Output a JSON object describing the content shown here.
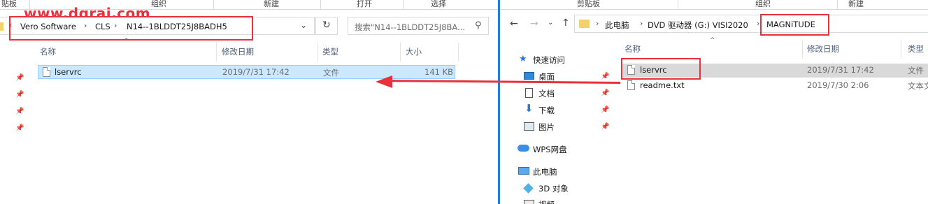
{
  "watermark": "www.dgrai.com",
  "left": {
    "ribbon": [
      "贴板",
      "组织",
      "新建",
      "打开",
      "选择"
    ],
    "address": {
      "crumbs": [
        "Vero Software",
        "CLS",
        "N14--1BLDDT25J8BADH5"
      ],
      "dropdown_icon": "chevron-down-icon",
      "refresh_icon": "refresh-icon"
    },
    "search": {
      "placeholder": "搜索\"N14--1BLDDT25J8BA..."
    },
    "columns": [
      "名称",
      "修改日期",
      "类型",
      "大小"
    ],
    "files": [
      {
        "name": "lservrc",
        "date": "2019/7/31 17:42",
        "type": "文件",
        "size": "141 KB",
        "selected": true
      }
    ]
  },
  "right": {
    "ribbon": [
      "剪贴板",
      "组织",
      "新建"
    ],
    "address": {
      "crumbs": [
        "此电脑",
        "DVD 驱动器 (G:) VISI2020",
        "MAGNiTUDE"
      ]
    },
    "columns": [
      "名称",
      "修改日期",
      "类型"
    ],
    "files": [
      {
        "name": "lservrc",
        "date": "2019/7/31 17:42",
        "type": "文件",
        "highlighted": true
      },
      {
        "name": "readme.txt",
        "date": "2019/7/30 2:06",
        "type": "文本文"
      }
    ],
    "nav": [
      {
        "label": "快速访问",
        "icon": "star-icon"
      },
      {
        "label": "桌面",
        "icon": "desktop-icon",
        "pinned": true
      },
      {
        "label": "文档",
        "icon": "document-icon",
        "pinned": true
      },
      {
        "label": "下载",
        "icon": "download-icon",
        "pinned": true
      },
      {
        "label": "图片",
        "icon": "picture-icon",
        "pinned": true
      },
      {
        "label": "WPS网盘",
        "icon": "cloud-icon"
      },
      {
        "label": "此电脑",
        "icon": "computer-icon"
      },
      {
        "label": "3D 对象",
        "icon": "cube-icon"
      },
      {
        "label": "视频",
        "icon": "video-icon"
      }
    ]
  },
  "colors": {
    "annotation": "#e8313b",
    "selection": "#cce8ff",
    "divider": "#1e7fe0",
    "folder": "#f4d16b"
  }
}
